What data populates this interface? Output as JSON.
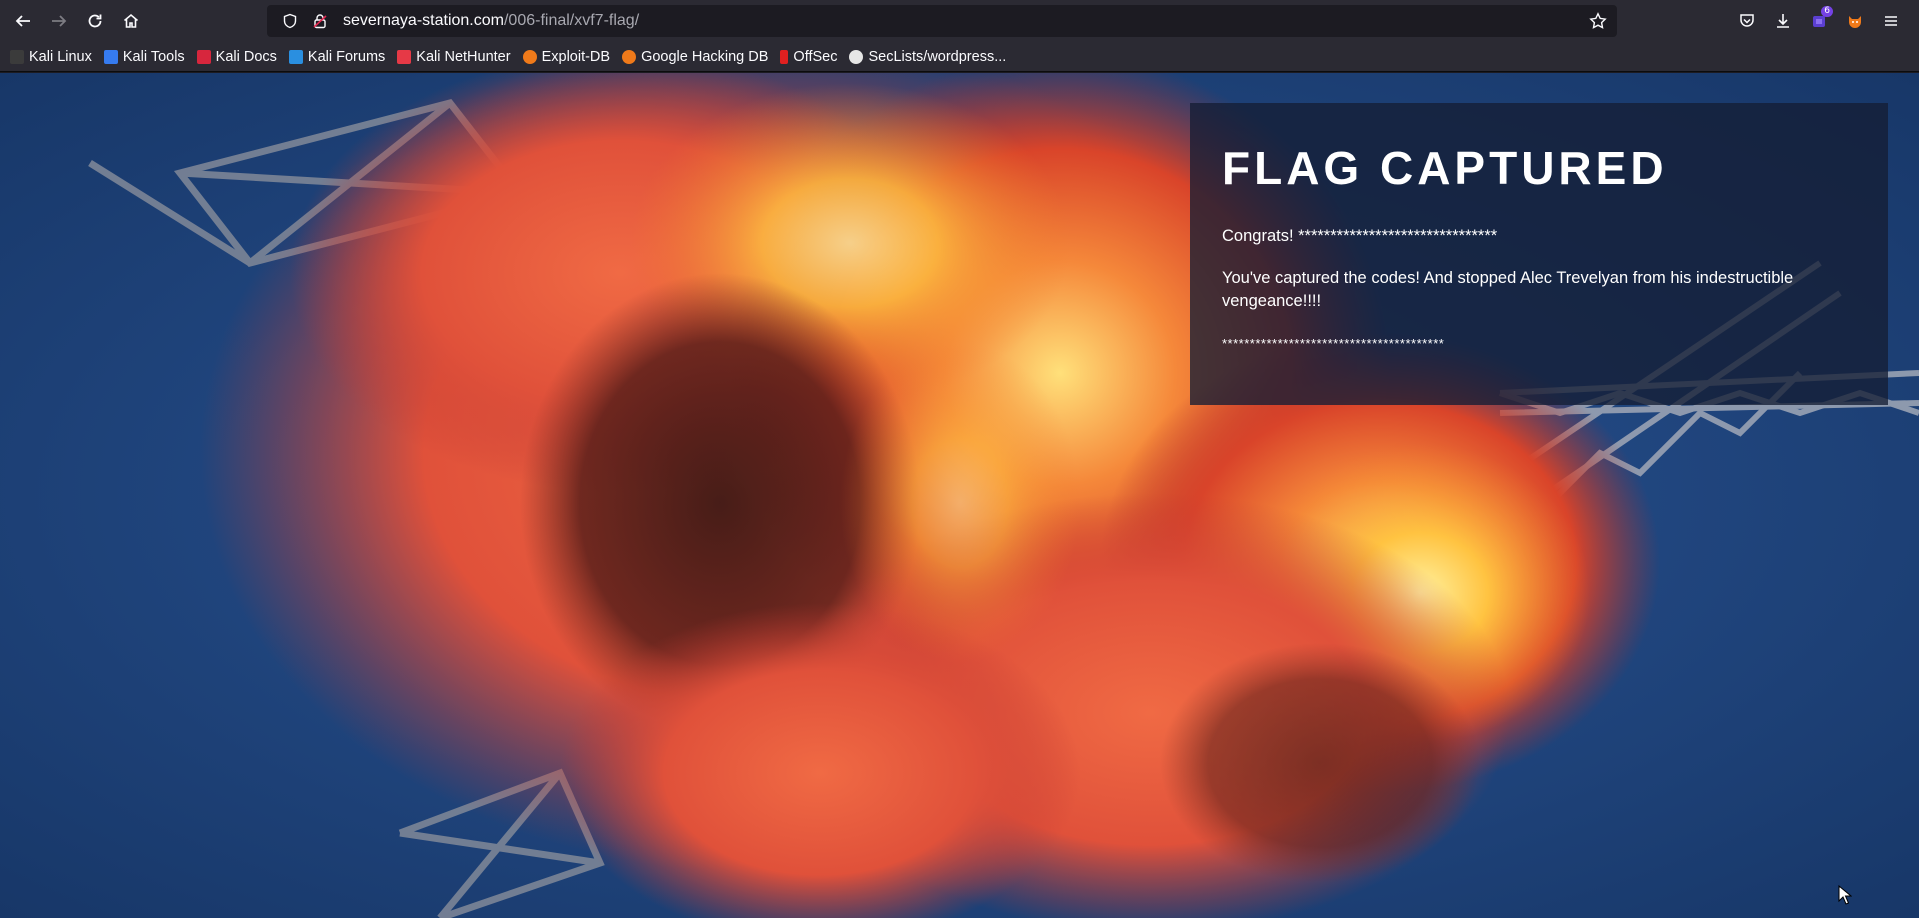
{
  "browser": {
    "url_domain": "severnaya-station.com",
    "url_path": "/006-final/xvf7-flag/",
    "extension_badge": "6"
  },
  "bookmarks": [
    {
      "label": "Kali Linux",
      "icon": "kali-dragon-icon",
      "color": "#3b3b3b"
    },
    {
      "label": "Kali Tools",
      "icon": "kali-tools-icon",
      "color": "#367bf0"
    },
    {
      "label": "Kali Docs",
      "icon": "kali-docs-icon",
      "color": "#d7263d"
    },
    {
      "label": "Kali Forums",
      "icon": "kali-forums-icon",
      "color": "#2a8fe0"
    },
    {
      "label": "Kali NetHunter",
      "icon": "nethunter-icon",
      "color": "#e63946"
    },
    {
      "label": "Exploit-DB",
      "icon": "exploit-db-icon",
      "color": "#f07a1a"
    },
    {
      "label": "Google Hacking DB",
      "icon": "ghdb-icon",
      "color": "#f07a1a"
    },
    {
      "label": "OffSec",
      "icon": "offsec-icon",
      "color": "#e02020"
    },
    {
      "label": "SecLists/wordpress...",
      "icon": "github-icon",
      "color": "#e6e6e6"
    }
  ],
  "page": {
    "title": "FLAG CAPTURED",
    "congrats": "Congrats! *******************************",
    "message": "You've captured the codes! And stopped Alec Trevelyan from his indestructible vengeance!!!!",
    "stars": "****************************************"
  },
  "colors": {
    "chrome_bg": "#2b2a33",
    "urlbar_bg": "#1c1b22",
    "panel_bg": "rgba(20,30,52,0.78)",
    "sky_blue": "#1d3f73",
    "fire_orange": "#e8532a",
    "fire_yellow": "#ffd24a"
  }
}
